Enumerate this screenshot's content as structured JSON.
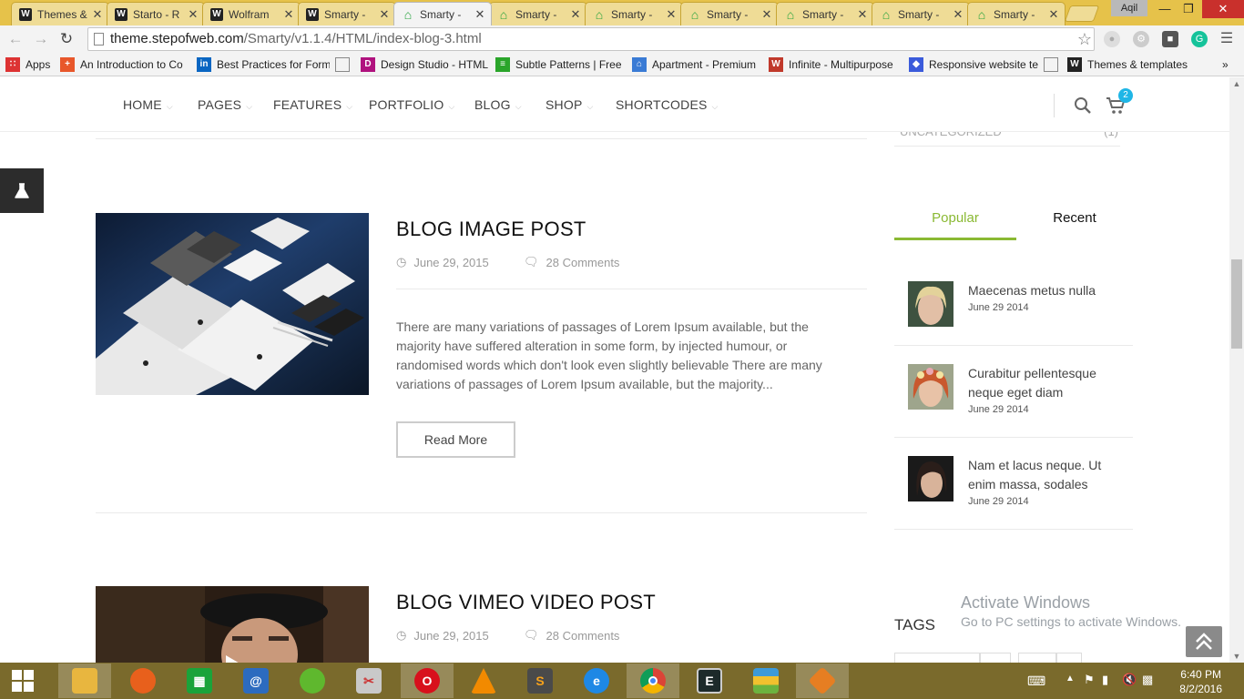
{
  "browser": {
    "tabs": [
      {
        "label": "Themes &",
        "favicon": "w"
      },
      {
        "label": "Starto - R",
        "favicon": "w"
      },
      {
        "label": "Wolfram",
        "favicon": "w"
      },
      {
        "label": "Smarty - ",
        "favicon": "w"
      },
      {
        "label": "Smarty - ",
        "favicon": "house",
        "active": true
      },
      {
        "label": "Smarty - ",
        "favicon": "house"
      },
      {
        "label": "Smarty - ",
        "favicon": "house"
      },
      {
        "label": "Smarty - ",
        "favicon": "house"
      },
      {
        "label": "Smarty - ",
        "favicon": "house"
      },
      {
        "label": "Smarty - ",
        "favicon": "house"
      },
      {
        "label": "Smarty - ",
        "favicon": "house"
      }
    ],
    "tab_close_glyph": "✕",
    "profile_name": "Aqil",
    "url_host": "theme.stepofweb.com",
    "url_path": "/Smarty/v1.1.4/HTML/index-blog-3.html",
    "bookmarks": [
      {
        "label": "Apps",
        "icon": "apps-grid-icon",
        "color": "#d33"
      },
      {
        "label": "An Introduction to Co",
        "icon": "plus-icon",
        "color": "#e8572b"
      },
      {
        "label": "Best Practices for Form",
        "icon": "linkedin-icon",
        "color": "#0a66c2"
      },
      {
        "label": "",
        "icon": "page-icon",
        "color": "#888"
      },
      {
        "label": "Design Studio - HTML",
        "icon": "d-icon",
        "color": "#b0127e"
      },
      {
        "label": "Subtle Patterns | Free",
        "icon": "pattern-icon",
        "color": "#2aa52a"
      },
      {
        "label": "Apartment - Premium",
        "icon": "house-icon",
        "color": "#3a7bd5"
      },
      {
        "label": "Infinite - Multipurpose",
        "icon": "wp-icon",
        "color": "#c0392b"
      },
      {
        "label": "Responsive website te",
        "icon": "shield-icon",
        "color": "#3b5bdb"
      },
      {
        "label": "",
        "icon": "page-icon",
        "color": "#888"
      },
      {
        "label": "Themes & templates",
        "icon": "w-icon",
        "color": "#222"
      }
    ],
    "bookmarks_more": "»"
  },
  "site": {
    "nav": [
      {
        "label": "HOME"
      },
      {
        "label": "PAGES"
      },
      {
        "label": "FEATURES"
      },
      {
        "label": "PORTFOLIO"
      },
      {
        "label": "BLOG"
      },
      {
        "label": "SHOP"
      },
      {
        "label": "SHORTCODES"
      }
    ],
    "nav_caret": "⌵",
    "cart_count": "2",
    "colors": {
      "accent": "#8ab933",
      "badge": "#1fb6e6"
    }
  },
  "posts": [
    {
      "title": "BLOG IMAGE POST",
      "date": "June 29, 2015",
      "comments": "28 Comments",
      "excerpt": "There are many variations of passages of Lorem Ipsum available, but the majority have suffered alteration in some form, by injected humour, or randomised words which don't look even slightly believable There are many variations of passages of Lorem Ipsum available, but the majority...",
      "read_more": "Read More"
    },
    {
      "title": "BLOG VIMEO VIDEO POST",
      "date": "June 29, 2015",
      "comments": "28 Comments"
    }
  ],
  "sidebar": {
    "category": {
      "name": "UNCATEGORIZED",
      "count": "(1)"
    },
    "tabs": {
      "popular": "Popular",
      "recent": "Recent"
    },
    "popular_posts": [
      {
        "title": "Maecenas metus nulla",
        "date": "June 29 2014"
      },
      {
        "title": "Curabitur pellentesque neque eget diam",
        "date": "June 29 2014"
      },
      {
        "title": "Nam et lacus neque. Ut enim massa, sodales",
        "date": "June 29 2014"
      }
    ],
    "tags_heading": "TAGS"
  },
  "os": {
    "watermark_title": "Activate Windows",
    "watermark_sub": "Go to PC settings to activate Windows.",
    "clock_time": "6:40 PM",
    "clock_date": "8/2/2016"
  }
}
